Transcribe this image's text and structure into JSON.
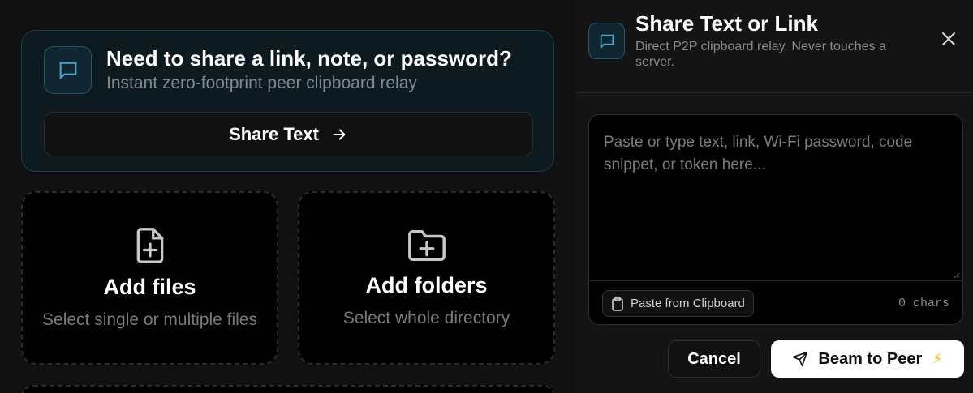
{
  "share_card": {
    "title": "Need to share a link, note, or password?",
    "subtitle": "Instant zero-footprint peer clipboard relay",
    "button_label": "Share Text",
    "icon": "message-square-icon"
  },
  "dropzones": {
    "files": {
      "title": "Add files",
      "subtitle": "Select single or multiple files",
      "icon": "file-plus-icon"
    },
    "folders": {
      "title": "Add folders",
      "subtitle": "Select whole directory",
      "icon": "folder-plus-icon"
    }
  },
  "panel": {
    "title": "Share Text or Link",
    "description": "Direct P2P clipboard relay. Never touches a server.",
    "icon": "message-square-icon",
    "close_icon": "close-icon",
    "textarea": {
      "value": "",
      "placeholder": "Paste or type text, link, Wi-Fi password, code snippet, or token here..."
    },
    "paste_button_label": "Paste from Clipboard",
    "char_count": "0 chars",
    "cancel_label": "Cancel",
    "beam_label": "Beam to Peer",
    "beam_emoji": "⚡"
  },
  "colors": {
    "background": "#111111",
    "accent": "#1f3d47",
    "accent_icon": "#4aa3c4",
    "primary_button": "#ffffff"
  }
}
